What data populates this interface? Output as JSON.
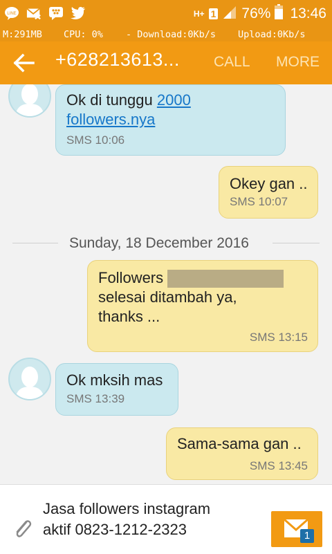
{
  "status_bar": {
    "notification_icons": [
      "line-icon",
      "missed-message-icon",
      "bbm-icon",
      "twitter-icon"
    ],
    "network_type": "H+",
    "sim_slot": "1",
    "battery_percent": "76%",
    "time": "13:46"
  },
  "monitor": {
    "memory": "M:291MB",
    "cpu": "CPU: 0%",
    "download": "- Download:0Kb/s",
    "upload": "Upload:0Kb/s"
  },
  "app_bar": {
    "title": "+628213613...",
    "call_label": "CALL",
    "more_label": "MORE"
  },
  "messages": [
    {
      "direction": "in",
      "text_before_link": "Ok di tunggu ",
      "link_text": "2000",
      "link_text_2": "followers.nya",
      "meta": "SMS 10:06"
    },
    {
      "direction": "out",
      "text": "Okey gan ..",
      "meta": "SMS 10:07"
    },
    {
      "direction": "out",
      "line1_prefix": "Followers ",
      "line2": "selesai ditambah ya,",
      "line3": "thanks ...",
      "meta": "SMS 13:15"
    },
    {
      "direction": "in",
      "text": "Ok mksih mas",
      "meta": "SMS 13:39"
    },
    {
      "direction": "out",
      "text": "Sama-sama gan ..",
      "meta": "SMS 13:45"
    }
  ],
  "date_divider": "Sunday, 18 December 2016",
  "compose": {
    "draft_line1": "Jasa followers instagram",
    "draft_line2": "aktif 0823-1212-2323",
    "send_badge": "1"
  },
  "colors": {
    "accent": "#f29a13",
    "incoming_bubble": "#cbe9ef",
    "outgoing_bubble": "#f9e9a4",
    "link": "#1677c9"
  }
}
